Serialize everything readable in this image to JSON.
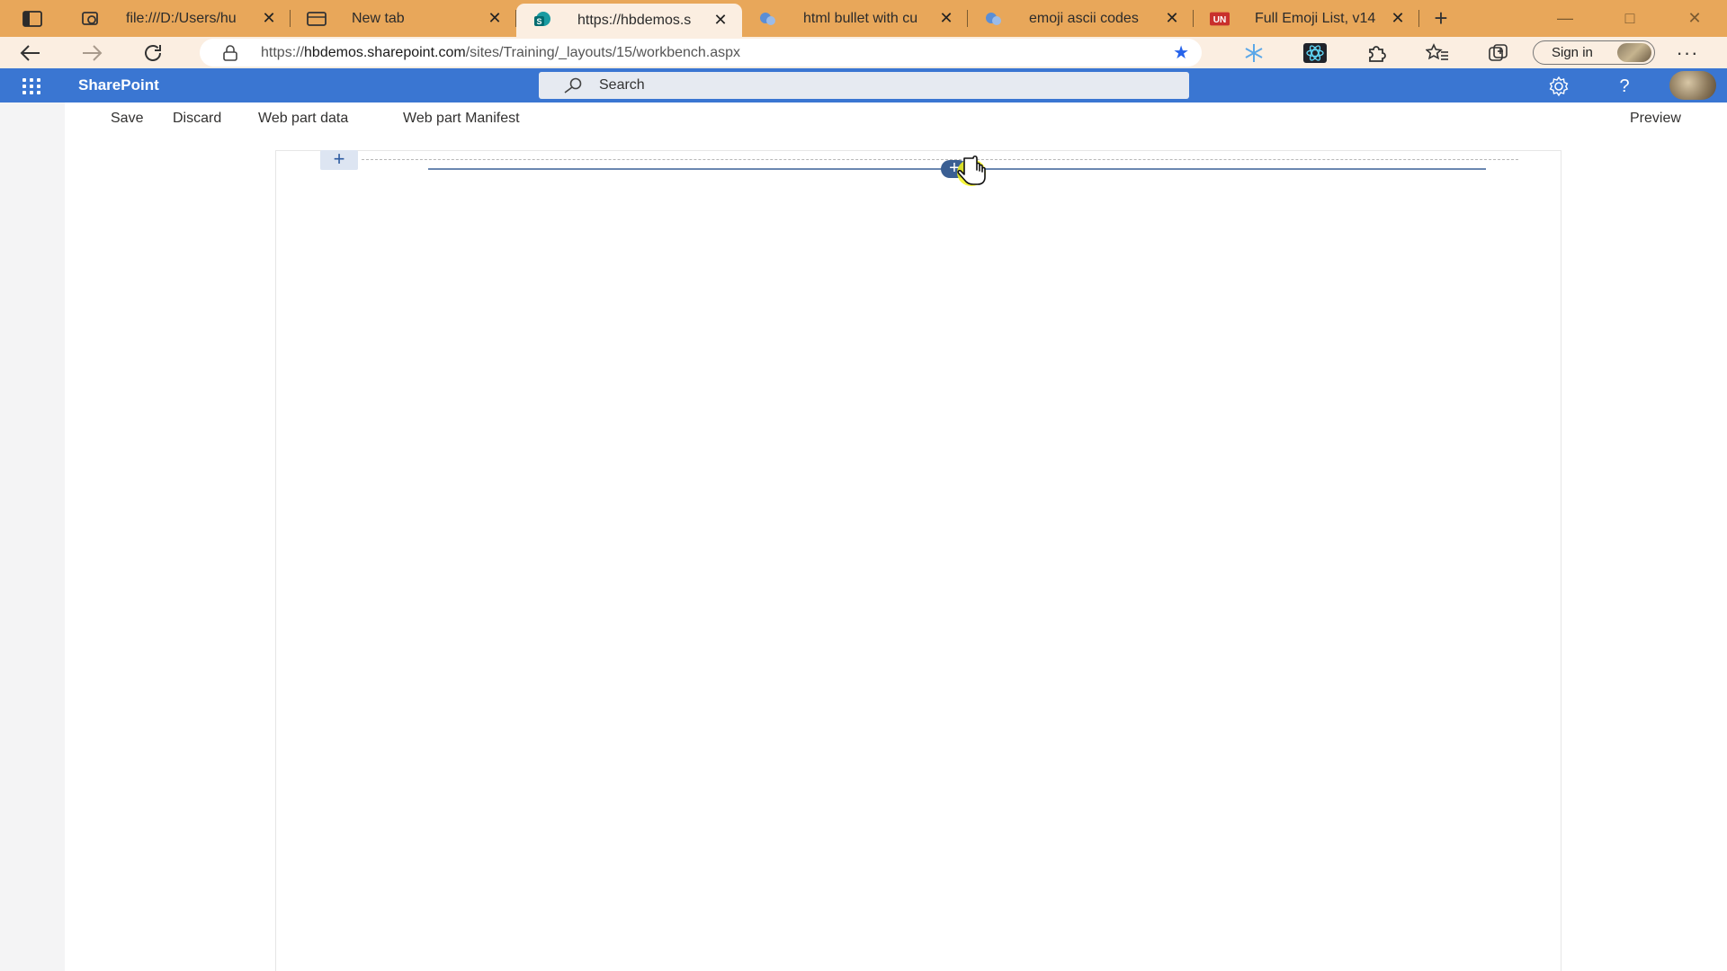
{
  "browser": {
    "tabs": [
      {
        "title": "file:///D:/Users/hu",
        "icon": "file-share-icon",
        "active": false
      },
      {
        "title": "New tab",
        "icon": "new-tab-icon",
        "active": false
      },
      {
        "title": "https://hbdemos.s",
        "icon": "sharepoint-icon",
        "active": true
      },
      {
        "title": "html bullet with cu",
        "icon": "search-favicon-icon",
        "active": false
      },
      {
        "title": "emoji ascii codes",
        "icon": "search-favicon-icon",
        "active": false
      },
      {
        "title": "Full Emoji List, v14",
        "icon": "unicode-icon",
        "active": false
      }
    ],
    "tab_close_glyph": "✕",
    "new_tab_glyph": "+",
    "address": {
      "prefix": "https://",
      "host": "hbdemos.sharepoint.com",
      "path": "/sites/Training/_layouts/15/workbench.aspx"
    },
    "sign_in_label": "Sign in",
    "more_glyph": "···",
    "colors": {
      "tab_strip": "#e8a75a",
      "toolbar": "#fbeee1"
    }
  },
  "suite": {
    "brand": "SharePoint",
    "search_placeholder": "Search",
    "help_glyph": "?",
    "accent_color": "#3a76d2"
  },
  "commands": {
    "save": "Save",
    "discard": "Discard",
    "web_part_data": "Web part data",
    "web_part_manifest": "Web part Manifest",
    "preview": "Preview"
  },
  "canvas": {
    "add_section_glyph": "+",
    "insert_webpart_glyph": "+"
  }
}
